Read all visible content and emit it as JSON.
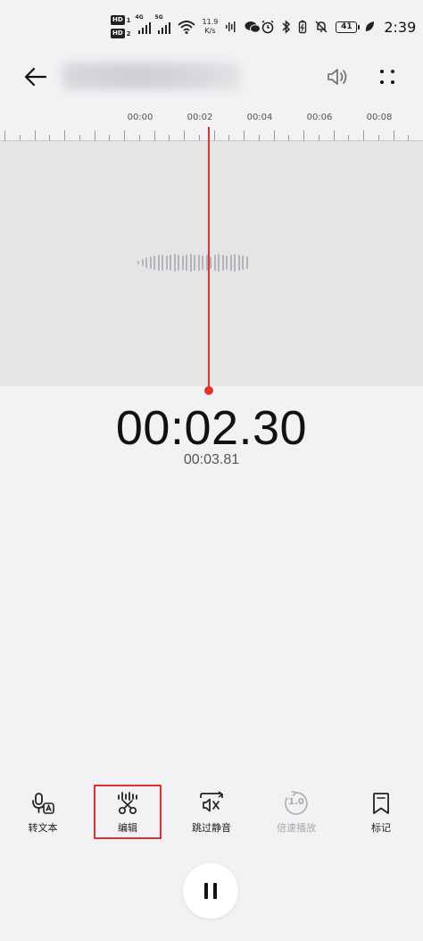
{
  "status_bar": {
    "hd1": "HD",
    "hd1_sim": "1",
    "hd2": "HD",
    "hd2_sim": "2",
    "net1": "4G",
    "net2": "5G",
    "speed_value": "11.9",
    "speed_unit": "K/s",
    "battery": "41",
    "time": "2:39"
  },
  "ruler": {
    "labels": [
      "00:00",
      "00:02",
      "00:04",
      "00:06",
      "00:08"
    ]
  },
  "player": {
    "current_time": "00:02.30",
    "total_time": "00:03.81"
  },
  "toolbar": {
    "items": [
      {
        "label": "转文本",
        "icon": "speech-to-text-icon"
      },
      {
        "label": "编辑",
        "icon": "cut-edit-icon"
      },
      {
        "label": "跳过静音",
        "icon": "skip-silence-icon"
      },
      {
        "label": "倍速播放",
        "icon": "playback-speed-icon",
        "badge": "1.0"
      },
      {
        "label": "标记",
        "icon": "bookmark-icon"
      }
    ]
  },
  "colors": {
    "accent": "#e0352b",
    "background": "#f2f2f4",
    "wave_area": "#e5e5e7"
  }
}
